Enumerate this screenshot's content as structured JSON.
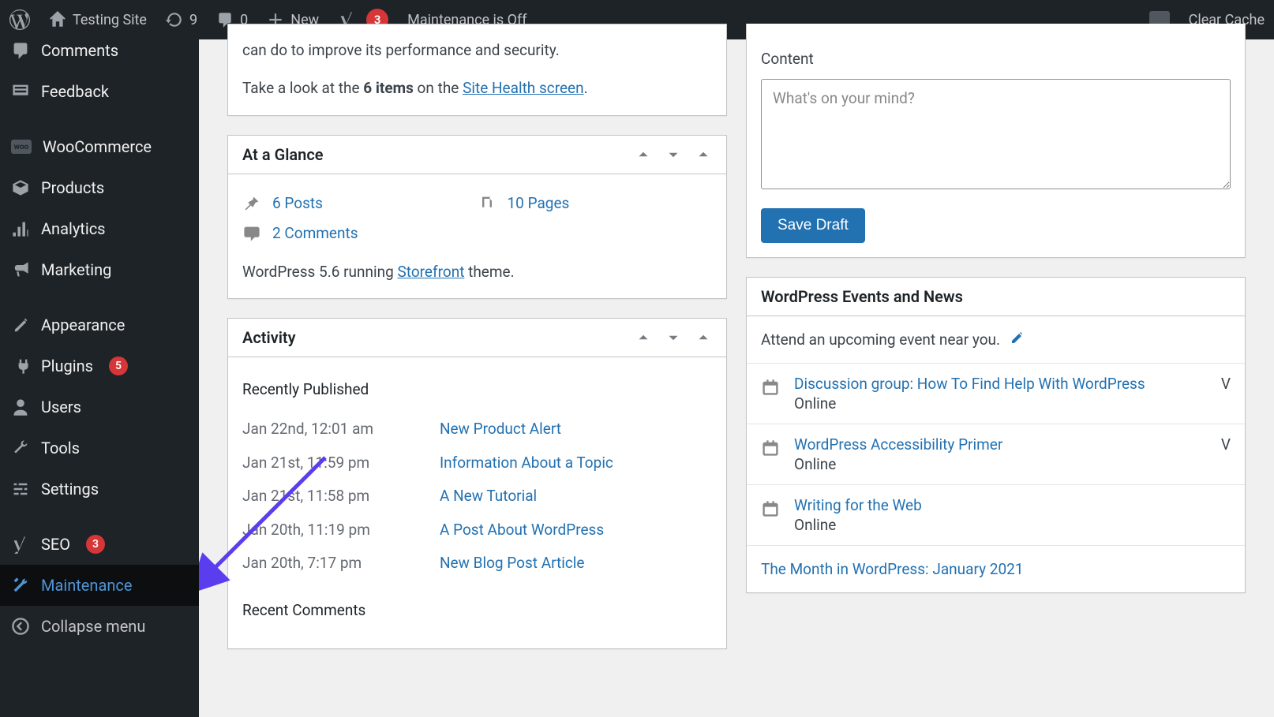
{
  "adminBar": {
    "siteName": "Testing Site",
    "updateCount": "9",
    "commentCount": "0",
    "newLabel": "New",
    "yoastBadge": "3",
    "maintenance": "Maintenance is Off",
    "clearCache": "Clear Cache"
  },
  "sidebar": {
    "comments": "Comments",
    "feedback": "Feedback",
    "woocommerce": "WooCommerce",
    "products": "Products",
    "analytics": "Analytics",
    "marketing": "Marketing",
    "appearance": "Appearance",
    "plugins": "Plugins",
    "pluginsBadge": "5",
    "users": "Users",
    "tools": "Tools",
    "settings": "Settings",
    "seo": "SEO",
    "seoBadge": "3",
    "maintenance": "Maintenance",
    "collapse": "Collapse menu"
  },
  "siteHealth": {
    "textA": "can do to improve its performance and security.",
    "textB_pre": "Take a look at the ",
    "textB_bold": "6 items",
    "textB_mid": " on the ",
    "textB_link": "Site Health screen",
    "textB_post": "."
  },
  "glance": {
    "title": "At a Glance",
    "posts": "6 Posts",
    "pages": "10 Pages",
    "comments": "2 Comments",
    "footer_pre": "WordPress 5.6 running ",
    "footer_link": "Storefront",
    "footer_post": " theme."
  },
  "activity": {
    "title": "Activity",
    "recentlyPublished": "Recently Published",
    "rows": [
      {
        "date": "Jan 22nd, 12:01 am",
        "title": "New Product Alert"
      },
      {
        "date": "Jan 21st, 11:59 pm",
        "title": "Information About a Topic"
      },
      {
        "date": "Jan 21st, 11:58 pm",
        "title": "A New Tutorial"
      },
      {
        "date": "Jan 20th, 11:19 pm",
        "title": "A Post About WordPress"
      },
      {
        "date": "Jan 20th, 7:17 pm",
        "title": "New Blog Post Article"
      }
    ],
    "recentComments": "Recent Comments"
  },
  "quickDraft": {
    "contentLabel": "Content",
    "placeholder": "What's on your mind?",
    "saveDraft": "Save Draft"
  },
  "events": {
    "title": "WordPress Events and News",
    "intro": "Attend an upcoming event near you.",
    "items": [
      {
        "title": "Discussion group: How To Find Help With WordPress",
        "loc": "Online",
        "letter": "V"
      },
      {
        "title": "WordPress Accessibility Primer",
        "loc": "Online",
        "letter": "V"
      },
      {
        "title": "Writing for the Web",
        "loc": "Online",
        "letter": ""
      }
    ],
    "news": "The Month in WordPress: January 2021"
  }
}
